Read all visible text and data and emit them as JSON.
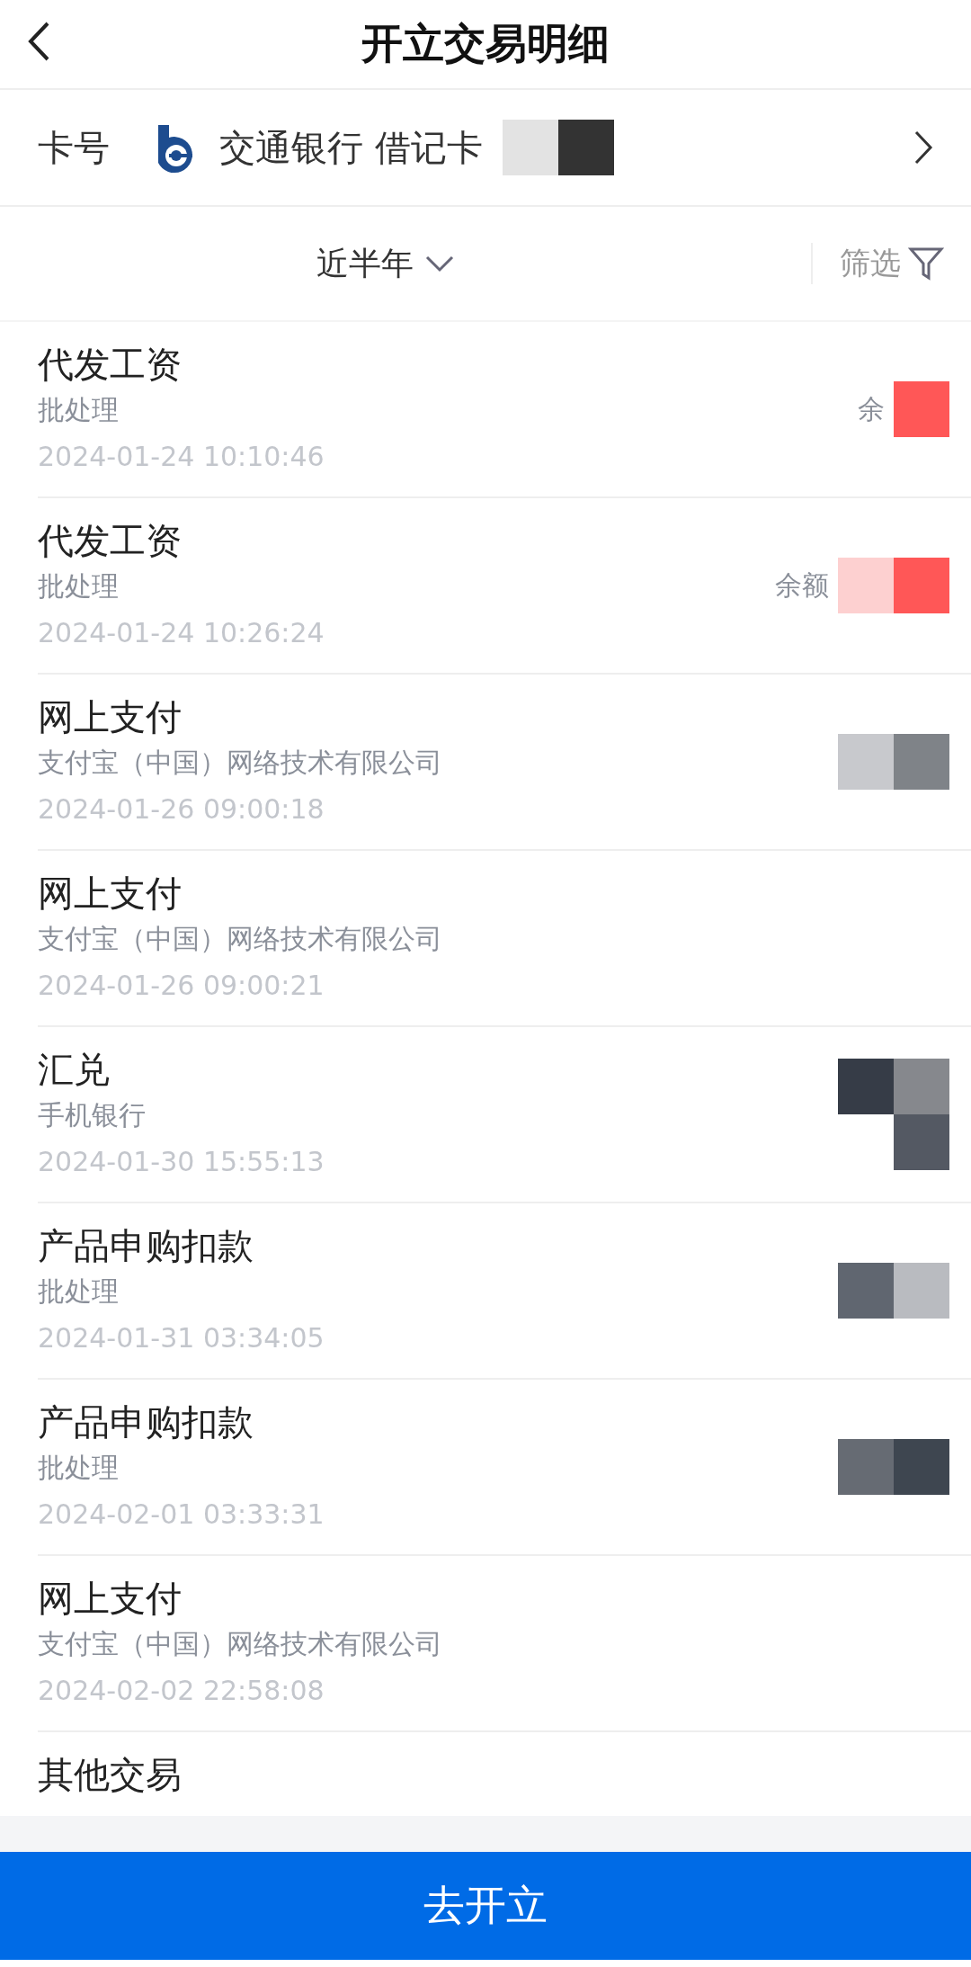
{
  "header": {
    "title": "开立交易明细"
  },
  "card": {
    "label": "卡号",
    "bank": "交通银行 借记卡",
    "redacted": true
  },
  "filter": {
    "period": "近半年",
    "filter_label": "筛选"
  },
  "transactions": [
    {
      "title": "代发工资",
      "subtitle": "批处理",
      "time": "2024-01-24 10:10:46",
      "balance_fragment": "余",
      "redacted": true
    },
    {
      "title": "代发工资",
      "subtitle": "批处理",
      "time": "2024-01-24 10:26:24",
      "balance_fragment": "余额",
      "redacted": true
    },
    {
      "title": "网上支付",
      "subtitle": "支付宝（中国）网络技术有限公司",
      "time": "2024-01-26 09:00:18",
      "redacted": true
    },
    {
      "title": "网上支付",
      "subtitle": "支付宝（中国）网络技术有限公司",
      "time": "2024-01-26 09:00:21",
      "redacted": false
    },
    {
      "title": "汇兑",
      "subtitle": "手机银行",
      "time": "2024-01-30 15:55:13",
      "redacted": true
    },
    {
      "title": "产品申购扣款",
      "subtitle": "批处理",
      "time": "2024-01-31 03:34:05",
      "redacted": true
    },
    {
      "title": "产品申购扣款",
      "subtitle": "批处理",
      "time": "2024-02-01 03:33:31",
      "redacted": true
    },
    {
      "title": "网上支付",
      "subtitle": "支付宝（中国）网络技术有限公司",
      "time": "2024-02-02 22:58:08",
      "redacted": false
    },
    {
      "title": "其他交易"
    }
  ],
  "action_button": "去开立"
}
